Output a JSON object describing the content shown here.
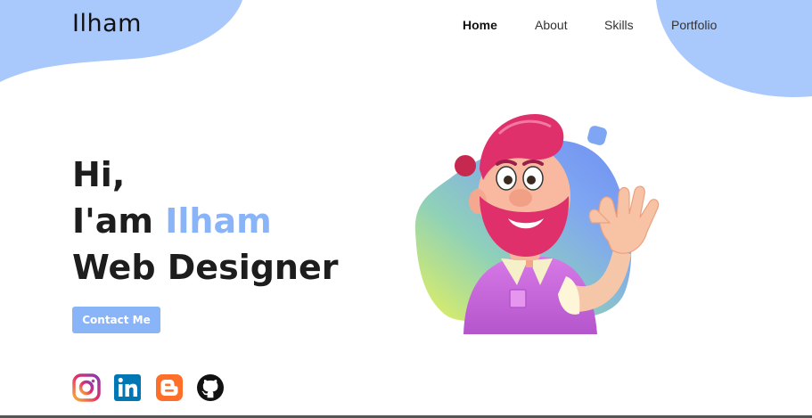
{
  "header": {
    "logo": "Ilham",
    "nav": [
      {
        "label": "Home",
        "active": true
      },
      {
        "label": "About",
        "active": false
      },
      {
        "label": "Skills",
        "active": false
      },
      {
        "label": "Portfolio",
        "active": false
      }
    ]
  },
  "hero": {
    "greeting": "Hi,",
    "intro_prefix": "I'am",
    "name": "Ilham",
    "role": "Web Designer",
    "contact_label": "Contact Me"
  },
  "social": [
    {
      "icon": "instagram-icon"
    },
    {
      "icon": "linkedin-icon"
    },
    {
      "icon": "blogger-icon"
    },
    {
      "icon": "github-icon"
    }
  ],
  "colors": {
    "accent": "#8ab4f8",
    "blob": "#a9c8fb",
    "text": "#1d1d1d"
  }
}
